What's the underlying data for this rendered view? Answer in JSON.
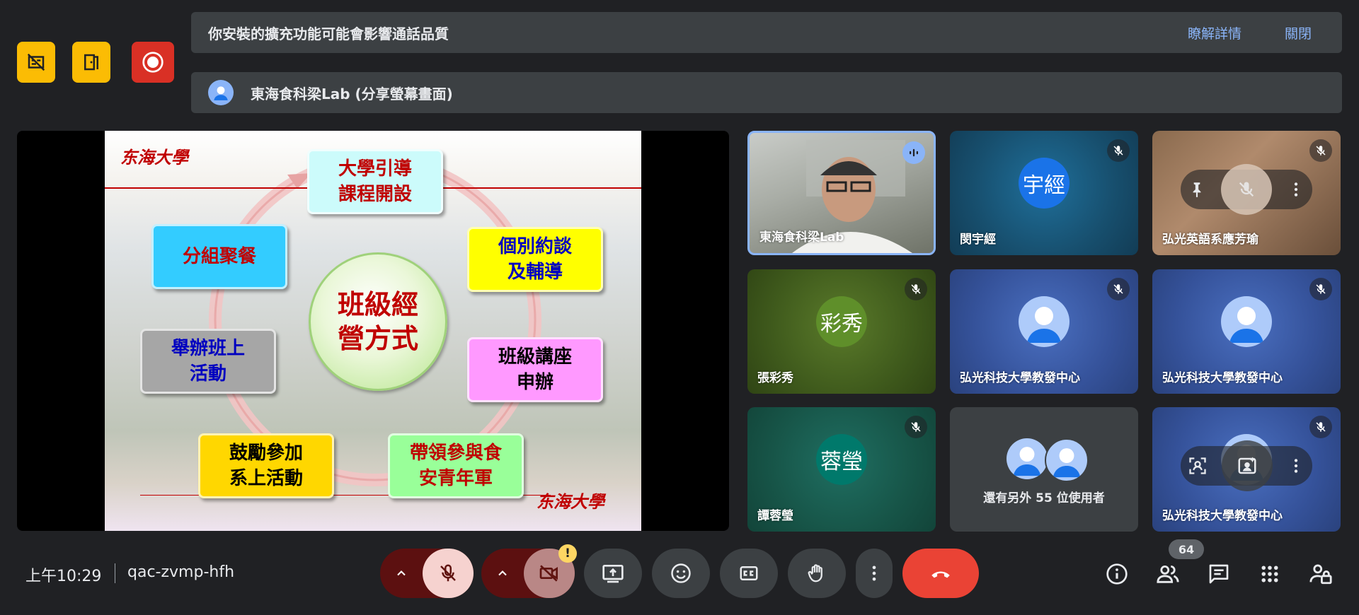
{
  "top_buttons": [
    {
      "icon": "captions-off-icon",
      "color": "#fbbc04"
    },
    {
      "icon": "door-exit-icon",
      "color": "#fbbc04"
    },
    {
      "icon": "record-icon",
      "color": "#d93025"
    }
  ],
  "banner_extension": {
    "text": "你安裝的擴充功能可能會影響通話品質",
    "learn_more": "瞭解詳情",
    "close": "關閉"
  },
  "banner_presenting": {
    "text": "東海食科梁Lab (分享螢幕畫面)"
  },
  "slide": {
    "logo_top": "东海大學",
    "logo_bottom": "东海大學",
    "center_text": "班級經營方式",
    "center_lines": [
      "班級經",
      "營方式"
    ],
    "boxes": [
      {
        "lines": [
          "大學引導",
          "課程開設"
        ],
        "bg": "#ccfbfb",
        "color": "#c00000"
      },
      {
        "lines": [
          "個別約談",
          "及輔導"
        ],
        "bg": "#ffff00",
        "color": "#0000c0"
      },
      {
        "lines": [
          "班級講座",
          "申辦"
        ],
        "bg": "#ff99ff",
        "color": "#000000"
      },
      {
        "lines": [
          "帶領參與食",
          "安青年軍"
        ],
        "bg": "#99ff99",
        "color": "#c00000"
      },
      {
        "lines": [
          "鼓勵參加",
          "系上活動"
        ],
        "bg": "#ffd700",
        "color": "#000000"
      },
      {
        "lines": [
          "舉辦班上",
          "活動"
        ],
        "bg": "#a6a6a6",
        "color": "#0000c0"
      },
      {
        "lines": [
          "分組聚餐"
        ],
        "bg": "#33ccff",
        "color": "#c00000"
      }
    ]
  },
  "participants": [
    {
      "name": "東海食科梁Lab",
      "type": "video",
      "speaking": true
    },
    {
      "name": "閔宇經",
      "initials": "宇經",
      "bg": "#1a73e8"
    },
    {
      "name": "弘光英語系應芳瑜",
      "type": "photo"
    },
    {
      "name": "張彩秀",
      "initials": "彩秀",
      "bg": "#5f8f2a"
    },
    {
      "name": "弘光科技大學教發中心"
    },
    {
      "name": "弘光科技大學教發中心"
    },
    {
      "name": "譚蓉瑩",
      "initials": "蓉瑩",
      "bg": "#00796b"
    },
    {
      "others_text": "還有另外 55 位使用者"
    },
    {
      "name": "弘光科技大學教發中心"
    }
  ],
  "bottom": {
    "time": "上午10:29",
    "meeting_code": "qac-zvmp-hfh",
    "people_count": "64",
    "warning_badge": "!"
  }
}
